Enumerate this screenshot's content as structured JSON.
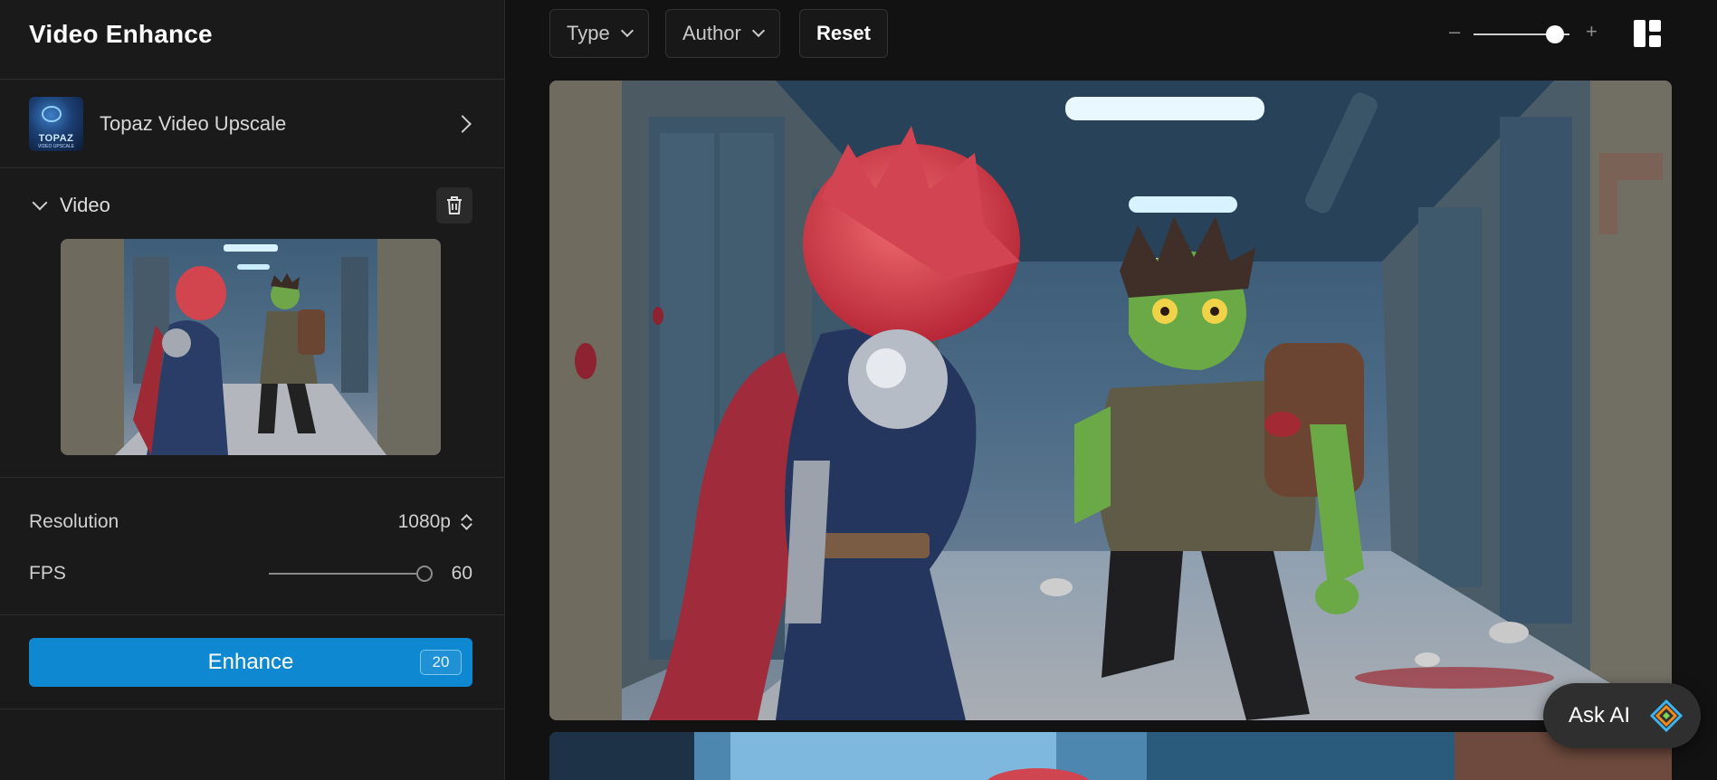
{
  "sidebar": {
    "title": "Video Enhance",
    "model": {
      "name": "Topaz Video Upscale",
      "thumb_label": "TOPAZ",
      "thumb_sublabel": "VIDEO UPSCALE"
    },
    "video_section": {
      "label": "Video"
    },
    "settings": {
      "resolution_label": "Resolution",
      "resolution_value": "1080p",
      "fps_label": "FPS",
      "fps_value": "60",
      "fps_slider_fraction": 1.0
    },
    "enhance": {
      "label": "Enhance",
      "credits": "20"
    }
  },
  "toolbar": {
    "type_label": "Type",
    "author_label": "Author",
    "reset_label": "Reset",
    "zoom_minus": "–",
    "zoom_plus": "+",
    "zoom_fraction": 0.85
  },
  "ask_ai": {
    "label": "Ask AI"
  },
  "colors": {
    "accent": "#0f88d2",
    "background": "#121212",
    "sidebar": "#1a1a1a"
  },
  "icons": {
    "model_arrow": "chevron-right-icon",
    "collapse": "chevron-down-icon",
    "delete": "trash-icon",
    "layout": "grid-layout-icon",
    "ask_ai": "cube-logo-icon"
  }
}
